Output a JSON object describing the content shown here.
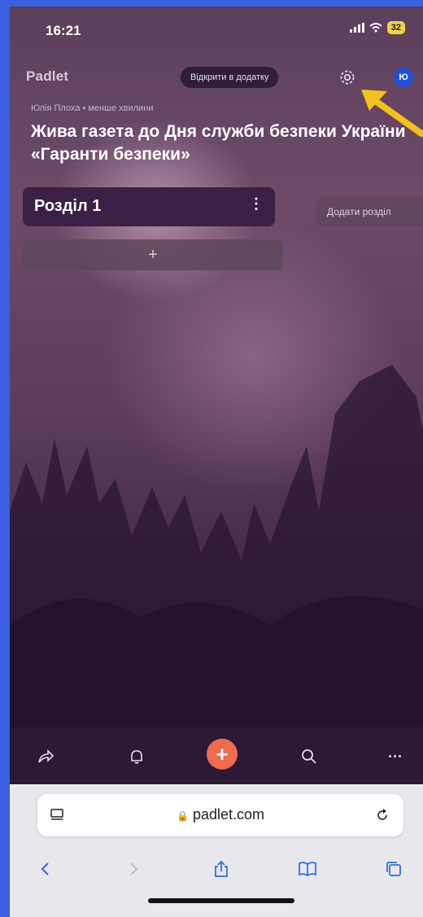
{
  "status": {
    "time": "16:21",
    "battery": "32"
  },
  "header": {
    "logo": "Padlet",
    "open_in_app": "Відкрити в додатку",
    "avatar_letter": "Ю"
  },
  "board": {
    "meta": "Юлія Плоха • менше хвилини",
    "title": "Жива газета до Дня служби безпеки України «Гаранти безпеки»"
  },
  "section": {
    "name": "Розділ 1",
    "menu": "⋮",
    "add_post": "+"
  },
  "add_section_label": "Додати розділ",
  "bottom_bar": {
    "icons": [
      "share-icon",
      "bell-icon",
      "plus-icon",
      "search-icon",
      "more-icon"
    ],
    "plus": "+",
    "more": "···",
    "accent": "#f06a4f"
  },
  "browser": {
    "url": "padlet.com",
    "lock": "🔒"
  },
  "annotation": {
    "arrow_color": "#f2c21a"
  }
}
